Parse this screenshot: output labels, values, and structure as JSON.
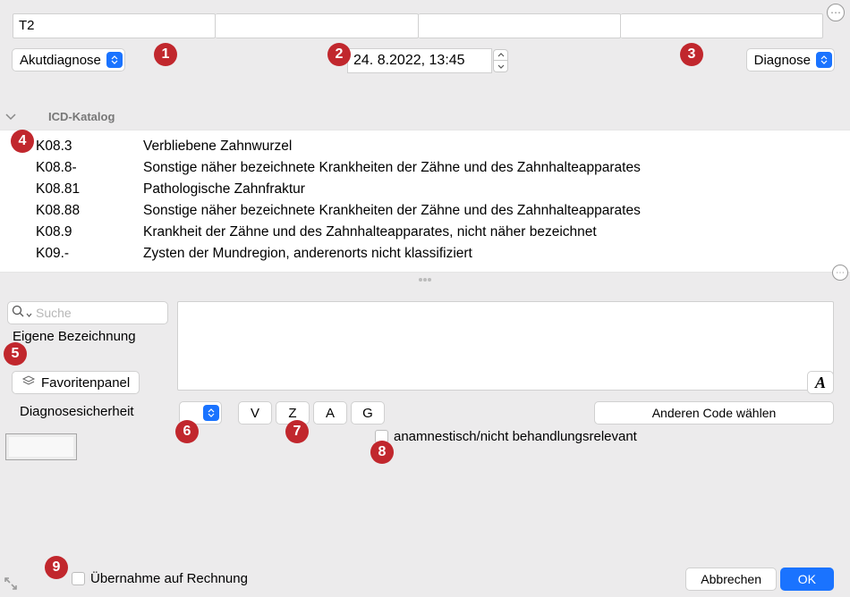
{
  "top": {
    "field1_value": "T2",
    "field2_value": "",
    "field3_value": "",
    "field4_value": "",
    "dropdown_left": "Akutdiagnose",
    "date_value": "24.  8.2022, 13:45",
    "dropdown_right": "Diagnose"
  },
  "icd": {
    "section_title": "ICD-Katalog",
    "rows": [
      {
        "code": "K08.3",
        "desc": "Verbliebene Zahnwurzel"
      },
      {
        "code": "K08.8-",
        "desc": "Sonstige näher bezeichnete Krankheiten der Zähne und des Zahnhalteapparates"
      },
      {
        "code": "K08.81",
        "desc": "Pathologische Zahnfraktur"
      },
      {
        "code": "K08.88",
        "desc": "Sonstige näher bezeichnete Krankheiten der Zähne und des Zahnhalteapparates"
      },
      {
        "code": "K08.9",
        "desc": "Krankheit der Zähne und des Zahnhalteapparates, nicht näher bezeichnet"
      },
      {
        "code": "K09.-",
        "desc": "Zysten der Mundregion, anderenorts nicht klassifiziert"
      }
    ]
  },
  "lower": {
    "search_placeholder": "Suche",
    "eigene_bezeichnung_label": "Eigene Bezeichnung",
    "favoriten_label": "Favoritenpanel",
    "diagnosesicherheit_label": "Diagnosesicherheit",
    "vzag": {
      "v": "V",
      "z": "Z",
      "a": "A",
      "g": "G"
    },
    "anderen_code_label": "Anderen Code wählen",
    "checkbox_anam_label": "anamnestisch/nicht behandlungsrelevant",
    "checkbox_ueber_label": "Übernahme auf Rechnung",
    "font_button_label": "A"
  },
  "footer": {
    "cancel": "Abbrechen",
    "ok": "OK"
  },
  "badges": [
    "1",
    "2",
    "3",
    "4",
    "5",
    "6",
    "7",
    "8",
    "9"
  ]
}
